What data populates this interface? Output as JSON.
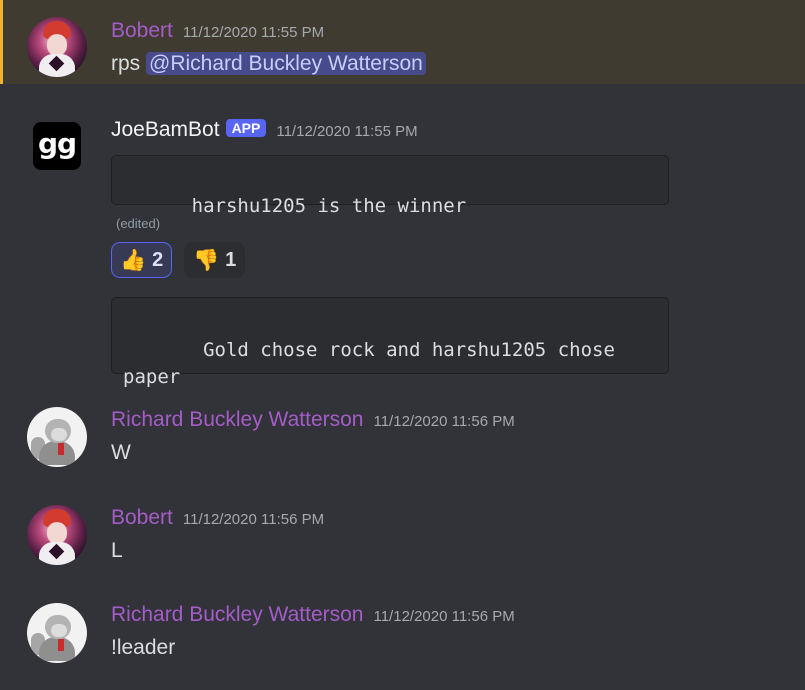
{
  "messages": [
    {
      "author": "Bobert",
      "timestamp": "11/12/2020 11:55 PM",
      "text": "rps",
      "mention": "@Richard Buckley Watterson"
    },
    {
      "author": "JoeBamBot",
      "badge": "APP",
      "timestamp": "11/12/2020 11:55 PM",
      "avatar_text": "gg",
      "code1": "harshu1205 is the winner",
      "edited": "(edited)",
      "reactions": [
        {
          "emoji": "👍",
          "count": "2",
          "icon": "thumbs-up-icon",
          "active": true
        },
        {
          "emoji": "👎",
          "count": "1",
          "icon": "thumbs-down-icon",
          "active": false
        }
      ],
      "code2": " Gold chose rock and harshu1205 chose paper"
    },
    {
      "author": "Richard Buckley Watterson",
      "timestamp": "11/12/2020 11:56 PM",
      "text": "W"
    },
    {
      "author": "Bobert",
      "timestamp": "11/12/2020 11:56 PM",
      "text": "L"
    },
    {
      "author": "Richard Buckley Watterson",
      "timestamp": "11/12/2020 11:56 PM",
      "text": "!leader"
    }
  ],
  "colors": {
    "background": "#313338",
    "mention_highlight": "#3f3b30",
    "mention_bar": "#f0b232",
    "author_purple": "#a55cc9",
    "app_badge": "#5865f2"
  }
}
